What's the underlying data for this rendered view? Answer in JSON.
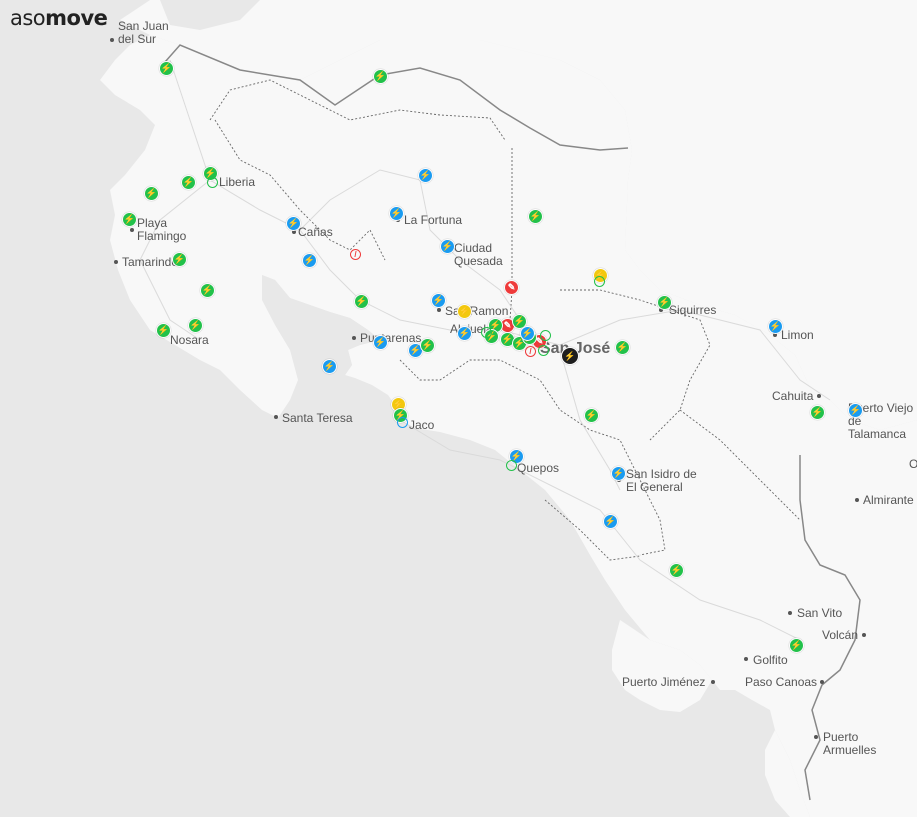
{
  "logo": {
    "part1": "aso",
    "part2": "move"
  },
  "colors": {
    "sea": "#e8e8e8",
    "land": "#f8f8f8",
    "green": "#22c14a",
    "blue": "#1a9bf0",
    "yellow": "#f2c80f",
    "red": "#ee3a3a",
    "black": "#1e1e1e"
  },
  "icons": {
    "charger": "lightning-bolt-icon",
    "fault": "wrench-icon",
    "blocked": "prohibited-icon"
  },
  "places": [
    {
      "id": "san-juan-del-sur",
      "label": "San Juan\ndel Sur"
    },
    {
      "id": "liberia",
      "label": "Liberia"
    },
    {
      "id": "playa-flamingo",
      "label": "Playa\nFlamingo"
    },
    {
      "id": "tamarindo",
      "label": "Tamarindo"
    },
    {
      "id": "canas",
      "label": "Cañas"
    },
    {
      "id": "la-fortuna",
      "label": "La Fortuna"
    },
    {
      "id": "ciudad-quesada",
      "label": "Ciudad\nQuesada"
    },
    {
      "id": "nosara",
      "label": "Nosara"
    },
    {
      "id": "san-ramon",
      "label": "San Ramon"
    },
    {
      "id": "alajuela",
      "label": "Alajuela"
    },
    {
      "id": "puntarenas",
      "label": "Puntarenas"
    },
    {
      "id": "san-jose",
      "label": "San José"
    },
    {
      "id": "siquirres",
      "label": "Siquirres"
    },
    {
      "id": "limon",
      "label": "Limon"
    },
    {
      "id": "santa-teresa",
      "label": "Santa Teresa"
    },
    {
      "id": "jaco",
      "label": "Jaco"
    },
    {
      "id": "cahuita",
      "label": "Cahuita"
    },
    {
      "id": "puerto-viejo",
      "label": "Puerto Viejo\nde Talamanca"
    },
    {
      "id": "quepos",
      "label": "Quepos"
    },
    {
      "id": "san-isidro",
      "label": "San Isidro de\nEl General"
    },
    {
      "id": "almirante",
      "label": "Almirante"
    },
    {
      "id": "san-vito",
      "label": "San Vito"
    },
    {
      "id": "volcan",
      "label": "Volcán"
    },
    {
      "id": "golfito",
      "label": "Golfito"
    },
    {
      "id": "puerto-jimenez",
      "label": "Puerto Jiménez"
    },
    {
      "id": "paso-canoas",
      "label": "Paso Canoas"
    },
    {
      "id": "puerto-armuelles",
      "label": "Puerto\nArmuelles"
    },
    {
      "id": "edge-o",
      "label": "O"
    }
  ]
}
